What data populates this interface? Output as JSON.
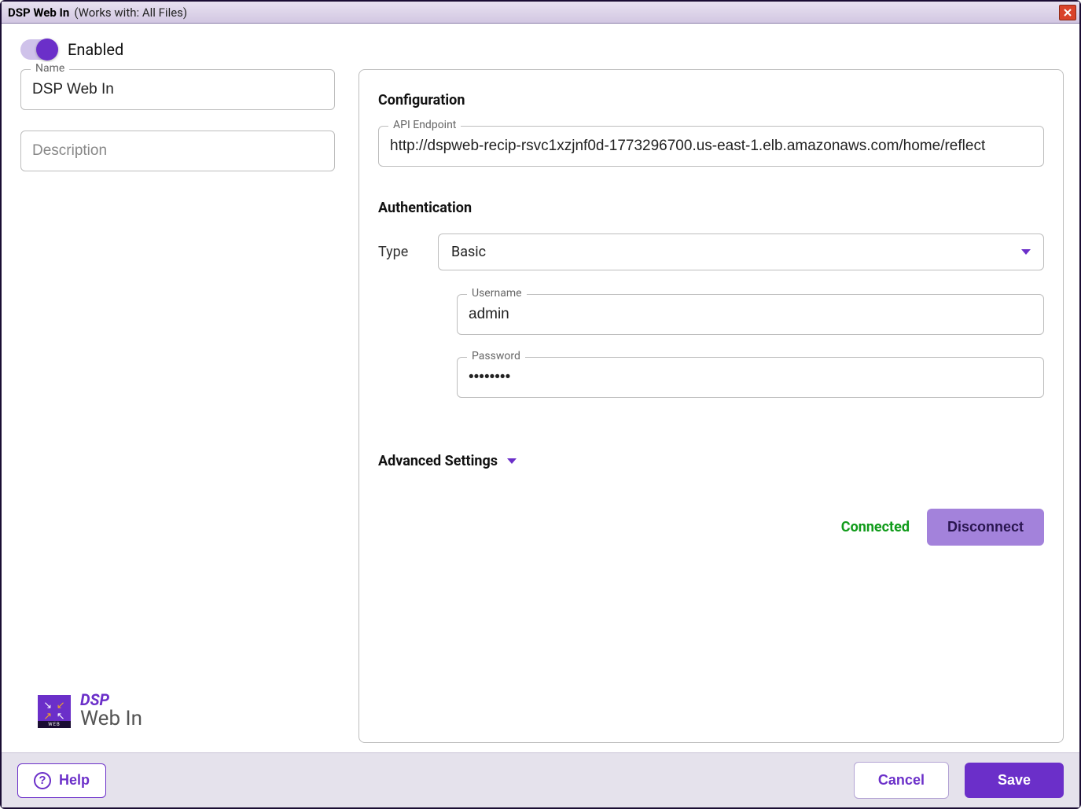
{
  "window": {
    "title_main": "DSP Web In",
    "title_sub": "(Works with: All Files)"
  },
  "toggle": {
    "label": "Enabled",
    "on": true
  },
  "left": {
    "name_label": "Name",
    "name_value": "DSP Web In",
    "description_placeholder": "Description",
    "description_value": ""
  },
  "config": {
    "section_title": "Configuration",
    "endpoint_label": "API Endpoint",
    "endpoint_value": "http://dspweb-recip-rsvc1xzjnf0d-1773296700.us-east-1.elb.amazonaws.com/home/reflect"
  },
  "auth": {
    "section_title": "Authentication",
    "type_label": "Type",
    "type_value": "Basic",
    "username_label": "Username",
    "username_value": "admin",
    "password_label": "Password",
    "password_value": "••••••••"
  },
  "advanced": {
    "label": "Advanced Settings"
  },
  "connection": {
    "status": "Connected",
    "button": "Disconnect"
  },
  "brand": {
    "line1": "DSP",
    "line2": "Web In",
    "mini": "WEB"
  },
  "footer": {
    "help": "Help",
    "cancel": "Cancel",
    "save": "Save"
  }
}
